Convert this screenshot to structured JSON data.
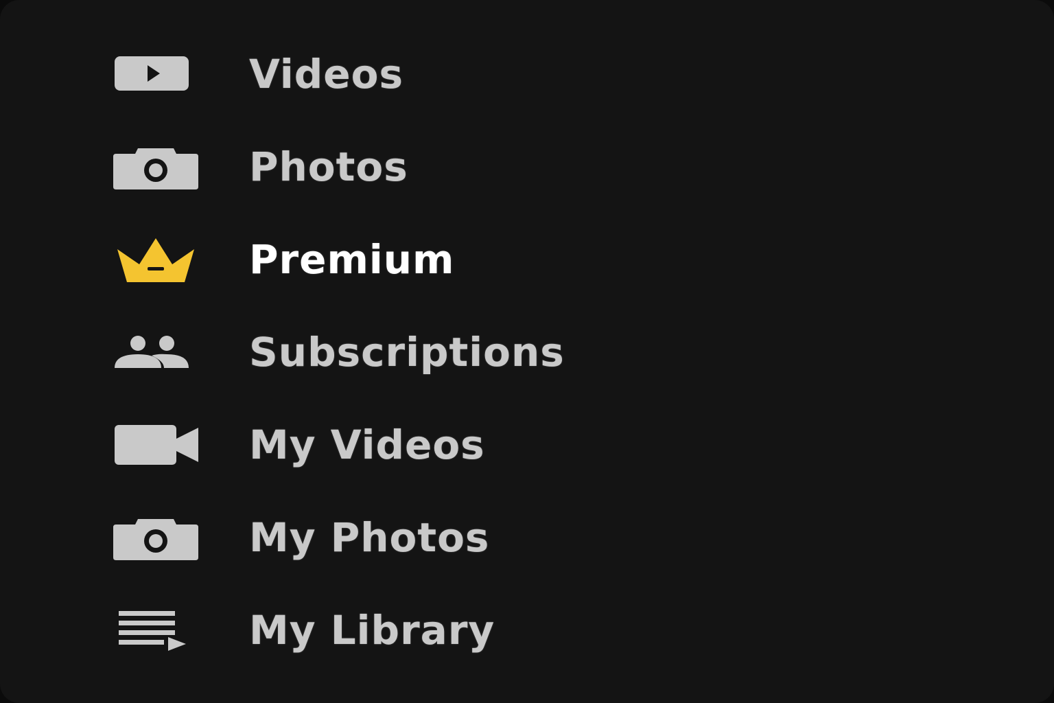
{
  "colors": {
    "background": "#141414",
    "label": "#c9c9c9",
    "label_active": "#ffffff",
    "icon": "#c9c9c9",
    "premium_accent": "#f4c430"
  },
  "menu": {
    "items": [
      {
        "label": "Videos",
        "icon": "play-box-icon"
      },
      {
        "label": "Photos",
        "icon": "camera-icon"
      },
      {
        "label": "Premium",
        "icon": "crown-icon",
        "active": true
      },
      {
        "label": "Subscriptions",
        "icon": "people-icon"
      },
      {
        "label": "My Videos",
        "icon": "video-camera-icon"
      },
      {
        "label": "My Photos",
        "icon": "camera-icon"
      },
      {
        "label": "My Library",
        "icon": "playlist-icon"
      }
    ]
  }
}
